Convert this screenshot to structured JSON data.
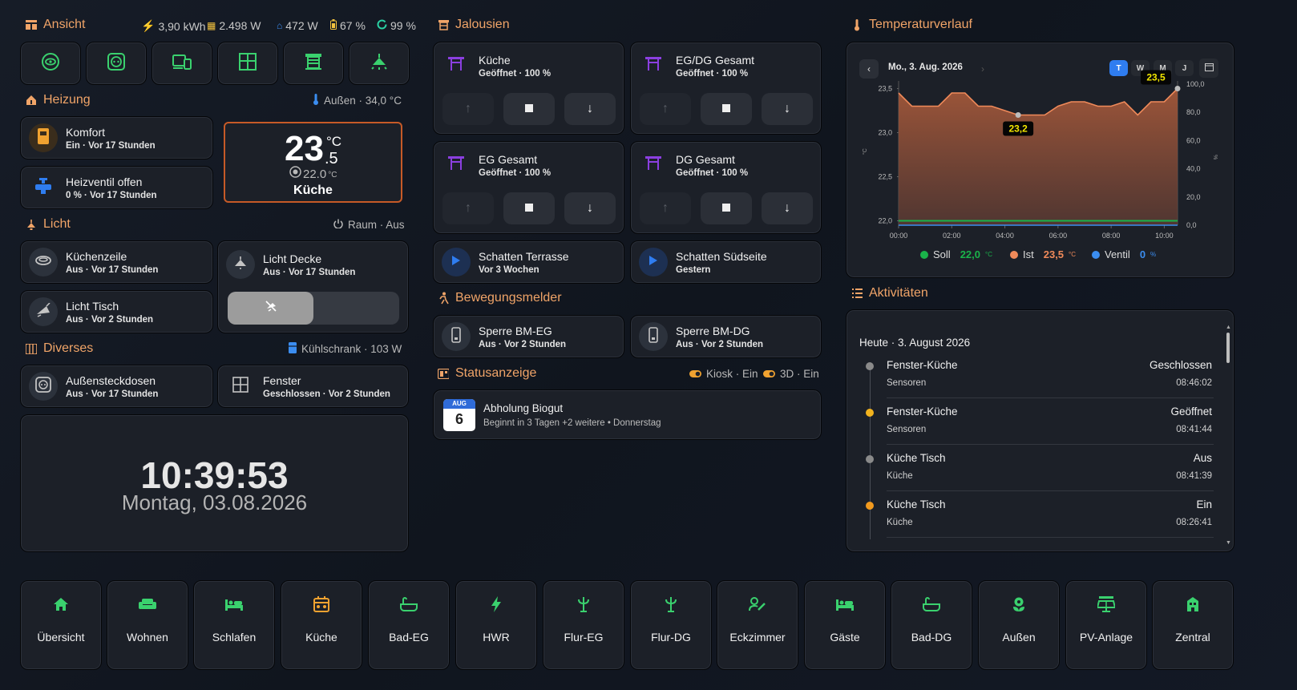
{
  "colors": {
    "accent": "#f0a468",
    "green": "#3ad16e",
    "purple": "#8b3fe0",
    "blue": "#2f6bd8",
    "orange": "#f09a3e"
  },
  "ansicht": {
    "title": "Ansicht",
    "stats": {
      "energy": "3,90 kWh",
      "solar": "2.498 W",
      "house": "472 W",
      "battery": "67 %",
      "autarky": "99 %"
    },
    "buttons": [
      "eye-icon",
      "socket-icon",
      "devices-icon",
      "window-icon",
      "blinds-icon",
      "ceiling-light-icon"
    ]
  },
  "heizung": {
    "title": "Heizung",
    "outside": "Außen · 34,0 °C",
    "komfort": {
      "name": "Komfort",
      "state": "Ein · Vor 17 Stunden"
    },
    "ventil": {
      "name": "Heizventil offen",
      "state": "0 % · Vor 17 Stunden"
    },
    "thermo": {
      "temp_int": "23",
      "temp_dec": ".5",
      "unit": "°C",
      "target": "22.0",
      "target_unit": "°C",
      "room": "Küche"
    }
  },
  "licht": {
    "title": "Licht",
    "right": "Raum · Aus",
    "kuechenzeile": {
      "name": "Küchenzeile",
      "state": "Aus · Vor 17 Stunden"
    },
    "tisch": {
      "name": "Licht Tisch",
      "state": "Aus · Vor 2 Stunden"
    },
    "decke": {
      "name": "Licht Decke",
      "state": "Aus · Vor 17 Stunden"
    }
  },
  "diverses": {
    "title": "Diverses",
    "right": "Kühlschrank · 103 W",
    "steckdosen": {
      "name": "Außensteckdosen",
      "state": "Aus · Vor 17 Stunden"
    },
    "fenster": {
      "name": "Fenster",
      "state": "Geschlossen · Vor 2 Stunden"
    }
  },
  "clock": {
    "time": "10:39:53",
    "date": "Montag, 03.08.2026"
  },
  "jalousien": {
    "title": "Jalousien",
    "covers": [
      {
        "name": "Küche",
        "state": "Geöffnet · 100 %"
      },
      {
        "name": "EG/DG Gesamt",
        "state": "Geöffnet · 100 %"
      },
      {
        "name": "EG Gesamt",
        "state": "Geöffnet · 100 %"
      },
      {
        "name": "DG Gesamt",
        "state": "Geöffnet · 100 %"
      }
    ],
    "scripts": [
      {
        "name": "Schatten Terrasse",
        "state": "Vor 3 Wochen"
      },
      {
        "name": "Schatten Südseite",
        "state": "Gestern"
      }
    ]
  },
  "bewegung": {
    "title": "Bewegungsmelder",
    "items": [
      {
        "name": "Sperre BM-EG",
        "state": "Aus · Vor 2 Stunden"
      },
      {
        "name": "Sperre BM-DG",
        "state": "Aus · Vor 2 Stunden"
      }
    ]
  },
  "status": {
    "title": "Statusanzeige",
    "kiosk": "Kiosk · Ein",
    "threed": "3D · Ein",
    "event": {
      "month": "AUG",
      "day": "6",
      "title": "Abholung Biogut",
      "sub": "Beginnt in 3 Tagen +2 weitere • Donnerstag"
    }
  },
  "temp": {
    "title": "Temperaturverlauf",
    "date": "Mo., 3. Aug. 2026",
    "ranges": [
      "T",
      "W",
      "M",
      "J"
    ],
    "legend": [
      {
        "name": "Soll",
        "value": "22,0",
        "unit": "°C"
      },
      {
        "name": "Ist",
        "value": "23,5",
        "unit": "°C"
      },
      {
        "name": "Ventil",
        "value": "0",
        "unit": "%"
      }
    ],
    "tooltip_min": "23,2",
    "tooltip_max": "23,5",
    "yleft_unit": "°C",
    "yright_unit": "%"
  },
  "chart_data": {
    "type": "area",
    "x": [
      "00:00",
      "00:30",
      "01:00",
      "01:30",
      "02:00",
      "02:30",
      "03:00",
      "03:30",
      "04:00",
      "04:30",
      "05:00",
      "05:30",
      "06:00",
      "06:30",
      "07:00",
      "07:30",
      "08:00",
      "08:30",
      "09:00",
      "09:30",
      "10:00",
      "10:30"
    ],
    "xticks": [
      "00:00",
      "02:00",
      "04:00",
      "06:00",
      "08:00",
      "10:00"
    ],
    "yleft": {
      "ticks": [
        "22,0",
        "22,5",
        "23,0",
        "23,5"
      ],
      "range": [
        21.95,
        23.55
      ]
    },
    "yright": {
      "ticks": [
        "0,0",
        "20,0",
        "40,0",
        "60,0",
        "80,0",
        "100,0"
      ],
      "range": [
        0,
        100
      ]
    },
    "series": [
      {
        "name": "Ist",
        "values": [
          23.45,
          23.3,
          23.3,
          23.3,
          23.45,
          23.45,
          23.3,
          23.3,
          23.25,
          23.2,
          23.2,
          23.2,
          23.3,
          23.35,
          23.35,
          23.3,
          23.3,
          23.35,
          23.2,
          23.35,
          23.35,
          23.5
        ]
      },
      {
        "name": "Soll",
        "values": [
          22.0,
          22.0,
          22.0,
          22.0,
          22.0,
          22.0,
          22.0,
          22.0,
          22.0,
          22.0,
          22.0,
          22.0,
          22.0,
          22.0,
          22.0,
          22.0,
          22.0,
          22.0,
          22.0,
          22.0,
          22.0,
          22.0
        ]
      },
      {
        "name": "Ventil",
        "values": [
          0,
          0,
          0,
          0,
          0,
          0,
          0,
          0,
          0,
          0,
          0,
          0,
          0,
          0,
          0,
          0,
          0,
          0,
          0,
          0,
          0,
          0
        ]
      }
    ]
  },
  "aktivitaeten": {
    "title": "Aktivitäten",
    "day": "Heute · 3. August 2026",
    "items": [
      {
        "name": "Fenster-Küche",
        "value": "Geschlossen",
        "sub": "Sensoren",
        "time": "08:46:02",
        "color": "#8a8a8a"
      },
      {
        "name": "Fenster-Küche",
        "value": "Geöffnet",
        "sub": "Sensoren",
        "time": "08:41:44",
        "color": "#f2b31e"
      },
      {
        "name": "Küche Tisch",
        "value": "Aus",
        "sub": "Küche",
        "time": "08:41:39",
        "color": "#8a8a8a"
      },
      {
        "name": "Küche Tisch",
        "value": "Ein",
        "sub": "Küche",
        "time": "08:26:41",
        "color": "#f29a1e"
      }
    ]
  },
  "nav": [
    "Übersicht",
    "Wohnen",
    "Schlafen",
    "Küche",
    "Bad-EG",
    "HWR",
    "Flur-EG",
    "Flur-DG",
    "Eckzimmer",
    "Gäste",
    "Bad-DG",
    "Außen",
    "PV-Anlage",
    "Zentral"
  ]
}
